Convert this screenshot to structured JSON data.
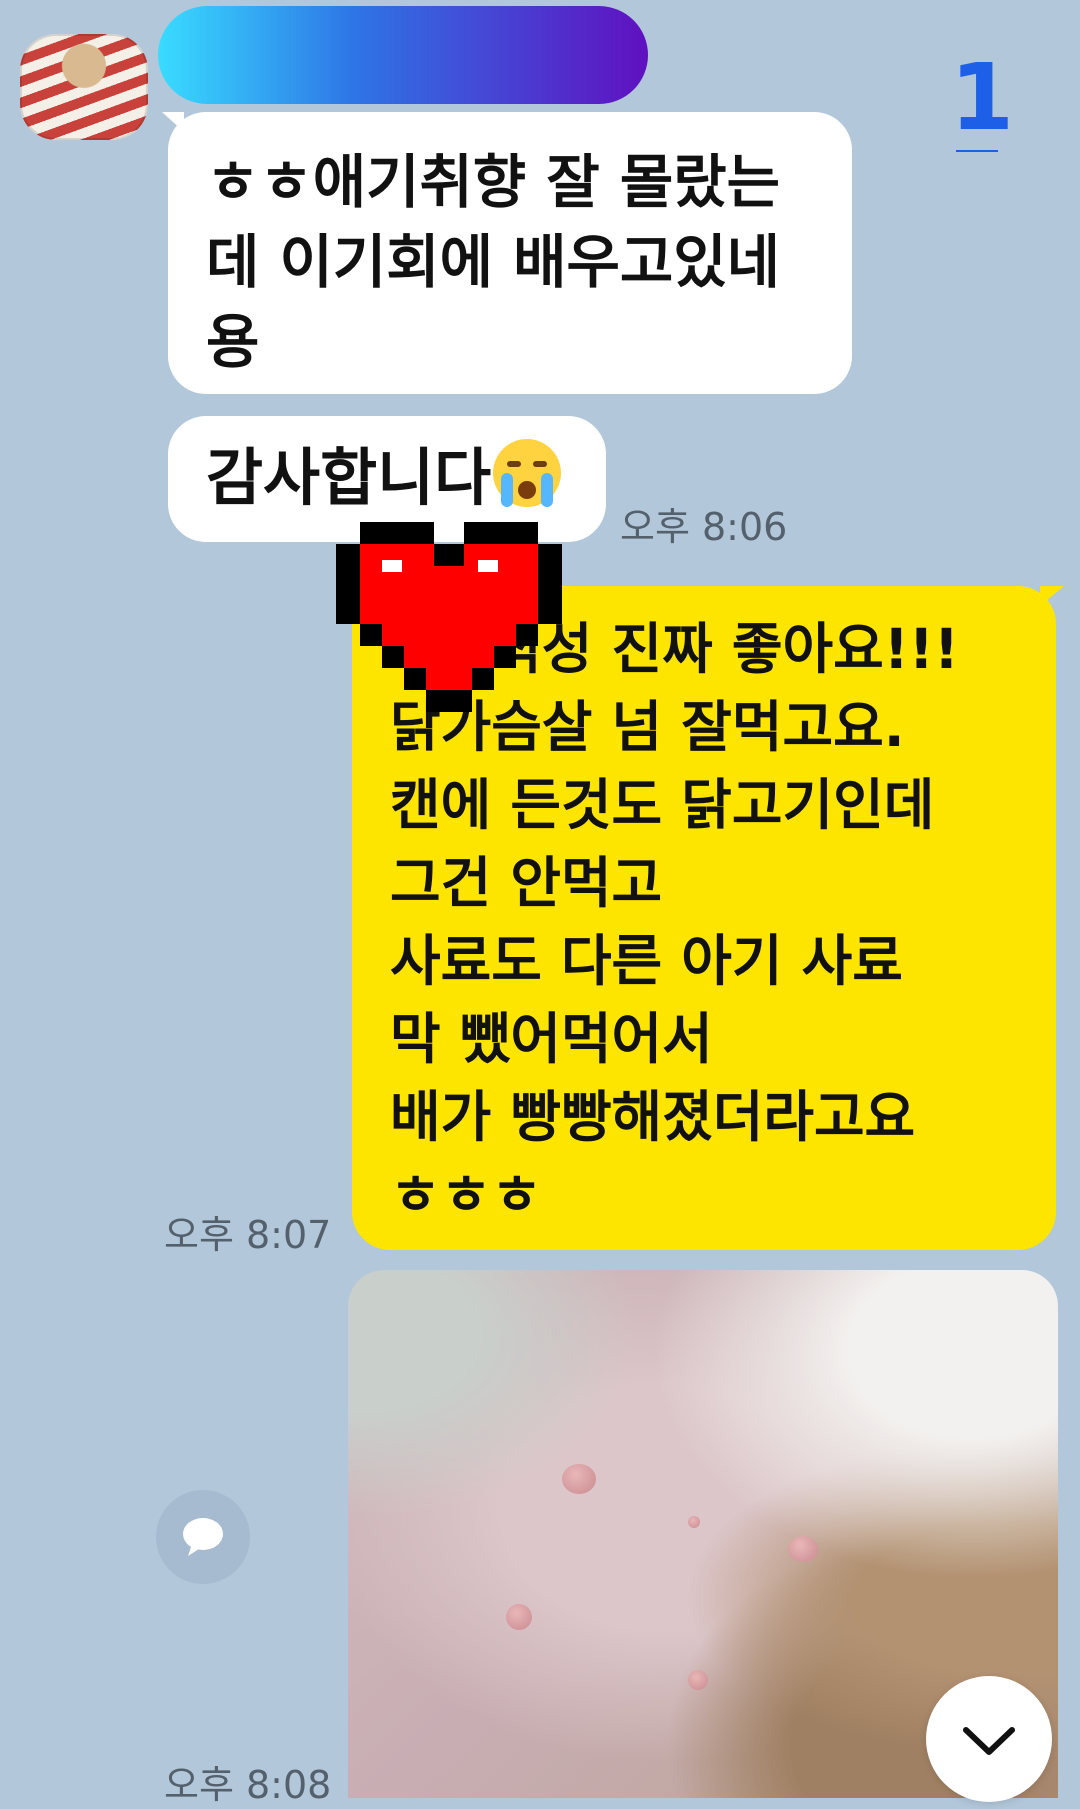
{
  "chat": {
    "unread_count": "1",
    "messages": [
      {
        "side": "received",
        "lines": [
          "ㅎㅎ애기취향 잘 몰랐는",
          "데 이기회에 배우고있네",
          "용"
        ]
      },
      {
        "side": "received",
        "text": "감사합니다",
        "emoji": "loudly-crying-face",
        "time": "오후 8:06"
      },
      {
        "side": "sent",
        "lines": [
          "기호식성 진짜 좋아요!!!",
          "닭가슴살 넘 잘먹고요.",
          "캔에 든것도 닭고기인데",
          "그건 안먹고",
          "사료도 다른 아기 사료",
          "막 뺐어먹어서",
          "배가 빵빵해졌더라고요",
          "ㅎㅎㅎ"
        ],
        "time": "오후 8:07"
      },
      {
        "side": "sent",
        "type": "photo",
        "time": "오후 8:08"
      }
    ]
  },
  "icons": {
    "reply": "speech-bubble-icon",
    "scroll_down": "chevron-down-icon",
    "overlay": "pixel-heart-sticker"
  },
  "colors": {
    "background": "#b2c7da",
    "received_bubble": "#ffffff",
    "sent_bubble": "#fee500",
    "unread": "#1e5fe8",
    "time_text": "#54606b"
  }
}
